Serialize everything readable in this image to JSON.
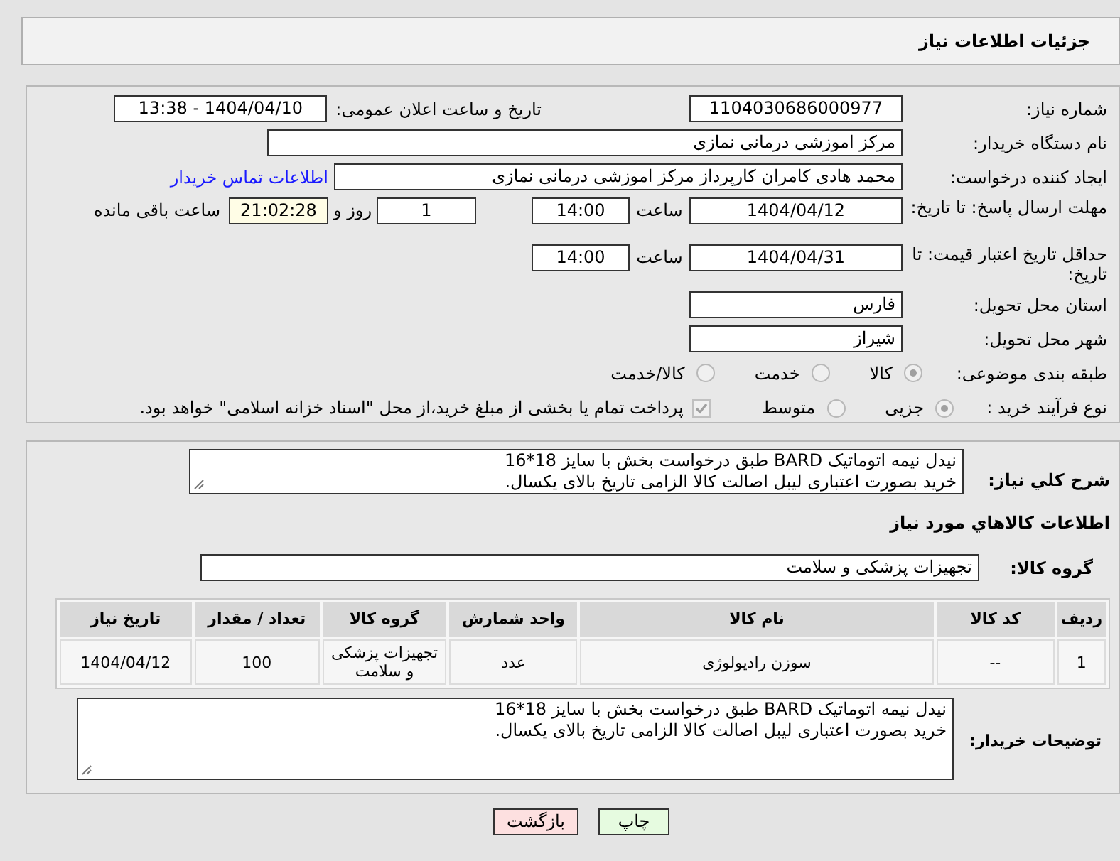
{
  "header": {
    "title": "جزئیات اطلاعات نیاز"
  },
  "form": {
    "need_number": {
      "label": "شماره نیاز:",
      "value": "1104030686000977"
    },
    "announce": {
      "label": "تاریخ و ساعت اعلان عمومی:",
      "value": "1404/04/10 - 13:38"
    },
    "buyer_org": {
      "label": "نام دستگاه خریدار:",
      "value": "مرکز اموزشی درمانی نمازی"
    },
    "creator": {
      "label": "ایجاد کننده درخواست:",
      "value": "محمد هادی کامران کارپرداز مرکز اموزشی درمانی نمازی",
      "link": "اطلاعات تماس خریدار"
    },
    "deadline": {
      "label": "مهلت ارسال پاسخ: تا تاریخ:",
      "date": "1404/04/12",
      "time_label": "ساعت",
      "time": "14:00",
      "days": "1",
      "days_label": "روز و",
      "remaining": "21:02:28",
      "remaining_label": "ساعت باقی مانده"
    },
    "validity": {
      "label": "حداقل تاریخ اعتبار قیمت: تا تاریخ:",
      "date": "1404/04/31",
      "time_label": "ساعت",
      "time": "14:00"
    },
    "province": {
      "label": "استان محل تحویل:",
      "value": "فارس"
    },
    "city": {
      "label": "شهر محل تحویل:",
      "value": "شیراز"
    },
    "category": {
      "label": "طبقه بندی موضوعی:",
      "options": [
        {
          "label": "کالا",
          "selected": true
        },
        {
          "label": "خدمت",
          "selected": false
        },
        {
          "label": "کالا/خدمت",
          "selected": false
        }
      ]
    },
    "process": {
      "label": "نوع فرآیند خرید :",
      "options": [
        {
          "label": "جزیی",
          "selected": true
        },
        {
          "label": "متوسط",
          "selected": false
        }
      ],
      "payment": {
        "checked": true,
        "text": "پرداخت تمام یا بخشی از مبلغ خرید،از محل \"اسناد خزانه اسلامی\" خواهد بود."
      }
    }
  },
  "details": {
    "description": {
      "label": "شرح کلي نياز:",
      "lines": [
        "نیدل نیمه اتوماتیک BARD طبق درخواست بخش با سایز 18*16",
        "خرید بصورت اعتباری لیبل اصالت کالا الزامی تاریخ بالای یکسال."
      ]
    },
    "section_title": "اطلاعات کالاهاي مورد نياز",
    "group": {
      "label": "گروه کالا:",
      "value": "تجهیزات پزشکی و سلامت"
    },
    "table": {
      "columns": [
        "ردیف",
        "کد کالا",
        "نام کالا",
        "واحد شمارش",
        "گروه کالا",
        "تعداد / مقدار",
        "تاریخ نیاز"
      ],
      "rows": [
        [
          "1",
          "--",
          "سوزن رادیولوژی",
          "عدد",
          "تجهیزات پزشکی و سلامت",
          "100",
          "1404/04/12"
        ]
      ]
    },
    "buyer_notes": {
      "label": "توضیحات خریدار:",
      "lines": [
        "نیدل نیمه اتوماتیک BARD طبق درخواست بخش با سایز 18*16",
        "خرید بصورت اعتباری لیبل اصالت کالا الزامی تاریخ بالای یکسال."
      ]
    }
  },
  "buttons": [
    {
      "kind": "print",
      "label": "چاپ"
    },
    {
      "kind": "back",
      "label": "بازگشت"
    }
  ]
}
